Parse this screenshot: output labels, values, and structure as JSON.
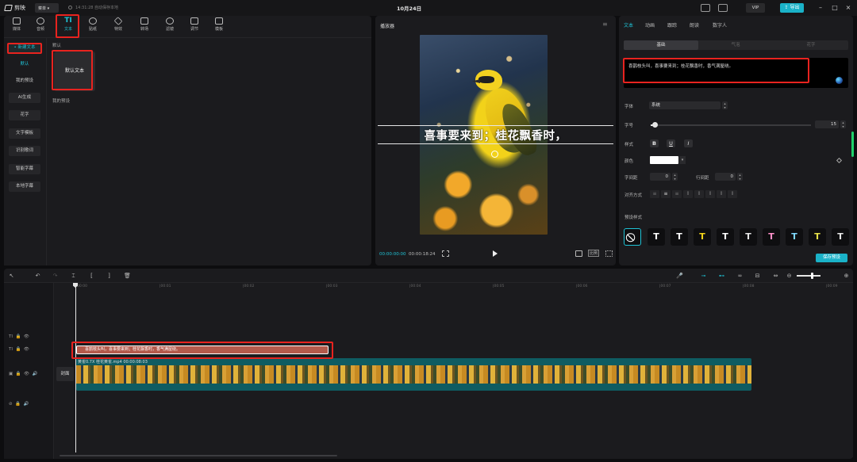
{
  "app": {
    "name": "剪映",
    "menu_label": "菜单",
    "save_status": "14:31:28 自动保存本地",
    "project_title": "10月24日",
    "vip_label": "VIP",
    "export_label": "导出"
  },
  "toolbar_tabs": [
    {
      "label": "媒体",
      "icon": "media-icon"
    },
    {
      "label": "音频",
      "icon": "audio-icon"
    },
    {
      "label": "文本",
      "icon": "text-icon",
      "glyph": "TI",
      "active": true
    },
    {
      "label": "贴纸",
      "icon": "sticker-icon"
    },
    {
      "label": "特效",
      "icon": "effects-icon"
    },
    {
      "label": "转场",
      "icon": "transition-icon"
    },
    {
      "label": "滤镜",
      "icon": "filter-icon"
    },
    {
      "label": "调节",
      "icon": "adjust-icon"
    },
    {
      "label": "模板",
      "icon": "template-icon"
    }
  ],
  "left_sidebar": {
    "new_text": "• 新建文本",
    "items": [
      "默认",
      "我的预设",
      "AI生成",
      "花字",
      "文字模板",
      "识别歌词",
      "智能字幕",
      "本地字幕"
    ]
  },
  "text_library": {
    "section_default": "默认",
    "default_card": "默认文本",
    "section_presets": "我的预设"
  },
  "player": {
    "title": "播放器",
    "subtitle": "喜事要来到；桂花飘香时，",
    "time_current": "00:00:00:00",
    "time_total": "00:00:18:24",
    "ratio_label": "比例"
  },
  "inspector": {
    "tabs": [
      "文本",
      "动画",
      "跟踪",
      "朗读",
      "数字人"
    ],
    "segments": [
      "基础",
      "气泡",
      "花字"
    ],
    "text_content": "喜鹊枝头叫，喜事要来到；桂花飘香时，香气满屋绕。",
    "font_label": "字体",
    "font_value": "系统",
    "size_label": "字号",
    "size_value": "15",
    "style_label": "样式",
    "style_buttons": [
      "B",
      "U",
      "I"
    ],
    "color_label": "颜色",
    "char_spacing_label": "字间距",
    "char_spacing_value": "0",
    "line_spacing_label": "行间距",
    "line_spacing_value": "0",
    "align_label": "对齐方式",
    "preset_label": "预设样式",
    "presets": [
      {
        "glyph": "⃠",
        "color": "#ffffff"
      },
      {
        "glyph": "T",
        "color": "#ffffff"
      },
      {
        "glyph": "T",
        "color": "#ffffff"
      },
      {
        "glyph": "T",
        "color": "#f2d21a"
      },
      {
        "glyph": "T",
        "color": "#ffffff"
      },
      {
        "glyph": "T",
        "color": "#e6e6e6"
      },
      {
        "glyph": "T",
        "color": "#ff8fc8"
      },
      {
        "glyph": "T",
        "color": "#7fd8ff"
      },
      {
        "glyph": "T",
        "color": "#e6e04a"
      },
      {
        "glyph": "T",
        "color": "#e6e6e6"
      }
    ],
    "save_preset": "保存预设"
  },
  "timeline": {
    "ruler": [
      "00:00",
      "|00:01",
      "|00:02",
      "|00:03",
      "|00:04",
      "|00:05",
      "|00:06",
      "|00:07",
      "|00:08",
      "|00:09"
    ],
    "text_clip_label": "喜鹊枝头叫，喜事要来到；桂花飘香时，香气满屋绕。",
    "video_clip_label": "黄雀0.7X   桂花黄雀.mp4   00:00:08:03",
    "cover_label": "封面"
  },
  "colors": {
    "accent": "#1fc3d6",
    "highlight_box": "#e8231f",
    "text_clip": "#b45a4b",
    "video_clip": "#0e5c62",
    "panel": "#1b1b1e",
    "background": "#0d0d0f"
  }
}
